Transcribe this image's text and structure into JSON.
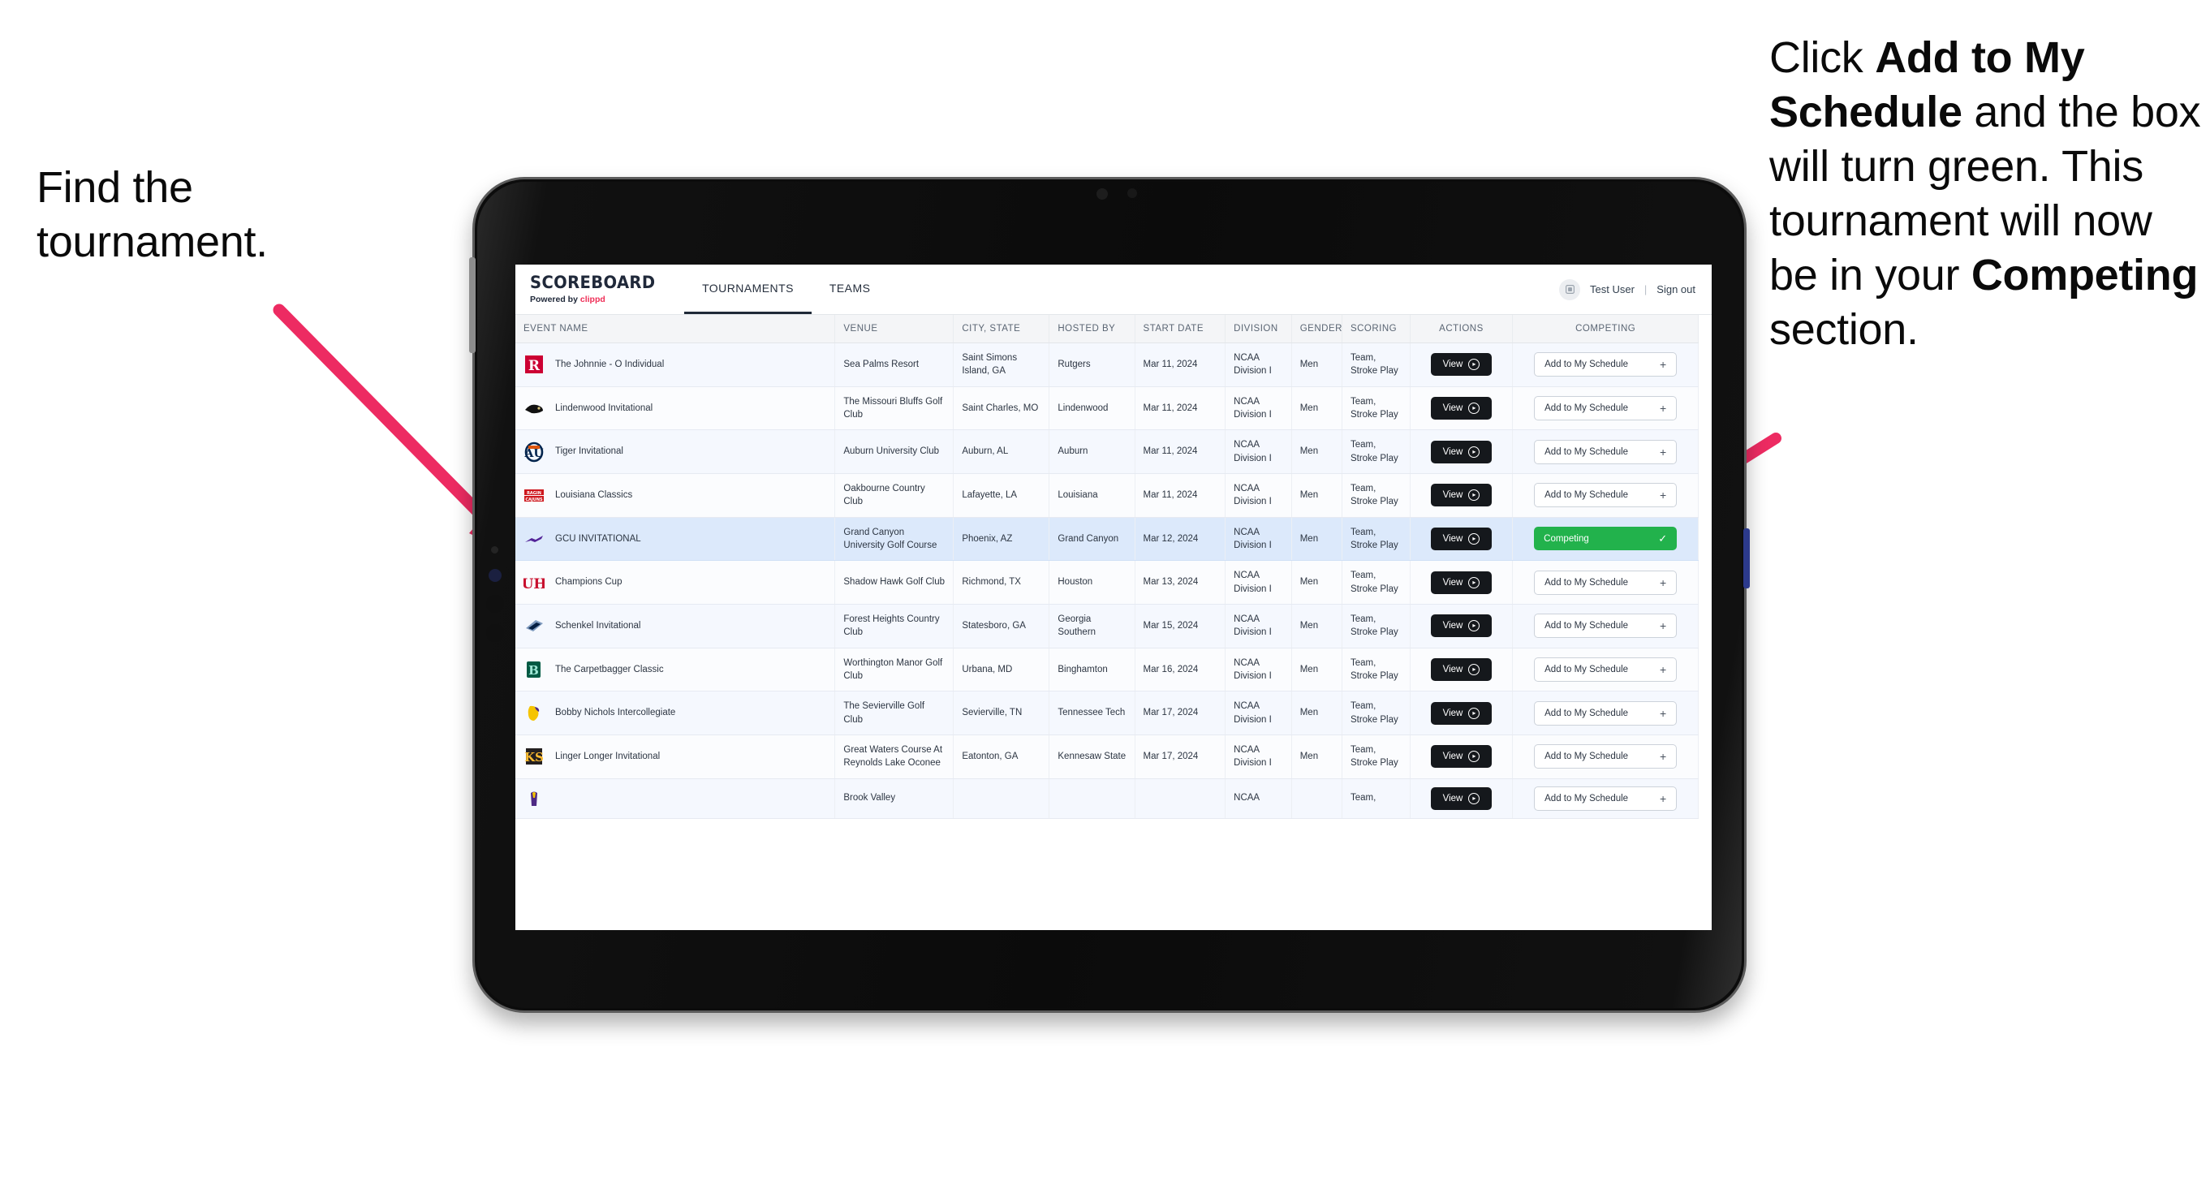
{
  "annotations": {
    "left": {
      "lines": [
        "Find the",
        "tournament."
      ]
    },
    "right": {
      "prefix": "Click ",
      "bold1": "Add to My Schedule",
      "middle": " and the box will turn green. This tournament will now be in your ",
      "bold2": "Competing",
      "suffix": " section."
    }
  },
  "app": {
    "brand": {
      "title": "SCOREBOARD",
      "powered_by": "Powered by ",
      "vendor": "clippd"
    },
    "nav": [
      {
        "label": "TOURNAMENTS",
        "active": true
      },
      {
        "label": "TEAMS",
        "active": false
      }
    ],
    "account": {
      "avatar_icon": "user-badge-icon",
      "user": "Test User",
      "separator": "|",
      "signout": "Sign out"
    }
  },
  "table": {
    "columns": [
      "EVENT NAME",
      "VENUE",
      "CITY, STATE",
      "HOSTED BY",
      "START DATE",
      "DIVISION",
      "GENDER",
      "SCORING",
      "ACTIONS",
      "COMPETING"
    ],
    "view_label": "View",
    "add_label": "Add to My Schedule",
    "competing_label": "Competing",
    "competing_color": "#22b24c",
    "rows": [
      {
        "event": "The Johnnie - O Individual",
        "logo": "rutgers-logo",
        "venue": "Sea Palms Resort",
        "city": "Saint Simons Island, GA",
        "hosted_by": "Rutgers",
        "start_date": "Mar 11, 2024",
        "division": "NCAA Division I",
        "gender": "Men",
        "scoring": "Team, Stroke Play",
        "competing": false
      },
      {
        "event": "Lindenwood Invitational",
        "logo": "lindenwood-logo",
        "venue": "The Missouri Bluffs Golf Club",
        "city": "Saint Charles, MO",
        "hosted_by": "Lindenwood",
        "start_date": "Mar 11, 2024",
        "division": "NCAA Division I",
        "gender": "Men",
        "scoring": "Team, Stroke Play",
        "competing": false
      },
      {
        "event": "Tiger Invitational",
        "logo": "auburn-logo",
        "venue": "Auburn University Club",
        "city": "Auburn, AL",
        "hosted_by": "Auburn",
        "start_date": "Mar 11, 2024",
        "division": "NCAA Division I",
        "gender": "Men",
        "scoring": "Team, Stroke Play",
        "competing": false
      },
      {
        "event": "Louisiana Classics",
        "logo": "ragin-cajuns-logo",
        "venue": "Oakbourne Country Club",
        "city": "Lafayette, LA",
        "hosted_by": "Louisiana",
        "start_date": "Mar 11, 2024",
        "division": "NCAA Division I",
        "gender": "Men",
        "scoring": "Team, Stroke Play",
        "competing": false
      },
      {
        "event": "GCU INVITATIONAL",
        "logo": "grand-canyon-logo",
        "venue": "Grand Canyon University Golf Course",
        "city": "Phoenix, AZ",
        "hosted_by": "Grand Canyon",
        "start_date": "Mar 12, 2024",
        "division": "NCAA Division I",
        "gender": "Men",
        "scoring": "Team, Stroke Play",
        "competing": true
      },
      {
        "event": "Champions Cup",
        "logo": "houston-logo",
        "venue": "Shadow Hawk Golf Club",
        "city": "Richmond, TX",
        "hosted_by": "Houston",
        "start_date": "Mar 13, 2024",
        "division": "NCAA Division I",
        "gender": "Men",
        "scoring": "Team, Stroke Play",
        "competing": false
      },
      {
        "event": "Schenkel Invitational",
        "logo": "georgia-southern-logo",
        "venue": "Forest Heights Country Club",
        "city": "Statesboro, GA",
        "hosted_by": "Georgia Southern",
        "start_date": "Mar 15, 2024",
        "division": "NCAA Division I",
        "gender": "Men",
        "scoring": "Team, Stroke Play",
        "competing": false
      },
      {
        "event": "The Carpetbagger Classic",
        "logo": "binghamton-logo",
        "venue": "Worthington Manor Golf Club",
        "city": "Urbana, MD",
        "hosted_by": "Binghamton",
        "start_date": "Mar 16, 2024",
        "division": "NCAA Division I",
        "gender": "Men",
        "scoring": "Team, Stroke Play",
        "competing": false
      },
      {
        "event": "Bobby Nichols Intercollegiate",
        "logo": "tennessee-tech-logo",
        "venue": "The Sevierville Golf Club",
        "city": "Sevierville, TN",
        "hosted_by": "Tennessee Tech",
        "start_date": "Mar 17, 2024",
        "division": "NCAA Division I",
        "gender": "Men",
        "scoring": "Team, Stroke Play",
        "competing": false
      },
      {
        "event": "Linger Longer Invitational",
        "logo": "kennesaw-state-logo",
        "venue": "Great Waters Course At Reynolds Lake Oconee",
        "city": "Eatonton, GA",
        "hosted_by": "Kennesaw State",
        "start_date": "Mar 17, 2024",
        "division": "NCAA Division I",
        "gender": "Men",
        "scoring": "Team, Stroke Play",
        "competing": false
      },
      {
        "event": "",
        "logo": "partial-logo",
        "venue": "Brook Valley",
        "city": "",
        "hosted_by": "",
        "start_date": "",
        "division": "NCAA",
        "gender": "",
        "scoring": "Team,",
        "competing": false
      }
    ]
  }
}
